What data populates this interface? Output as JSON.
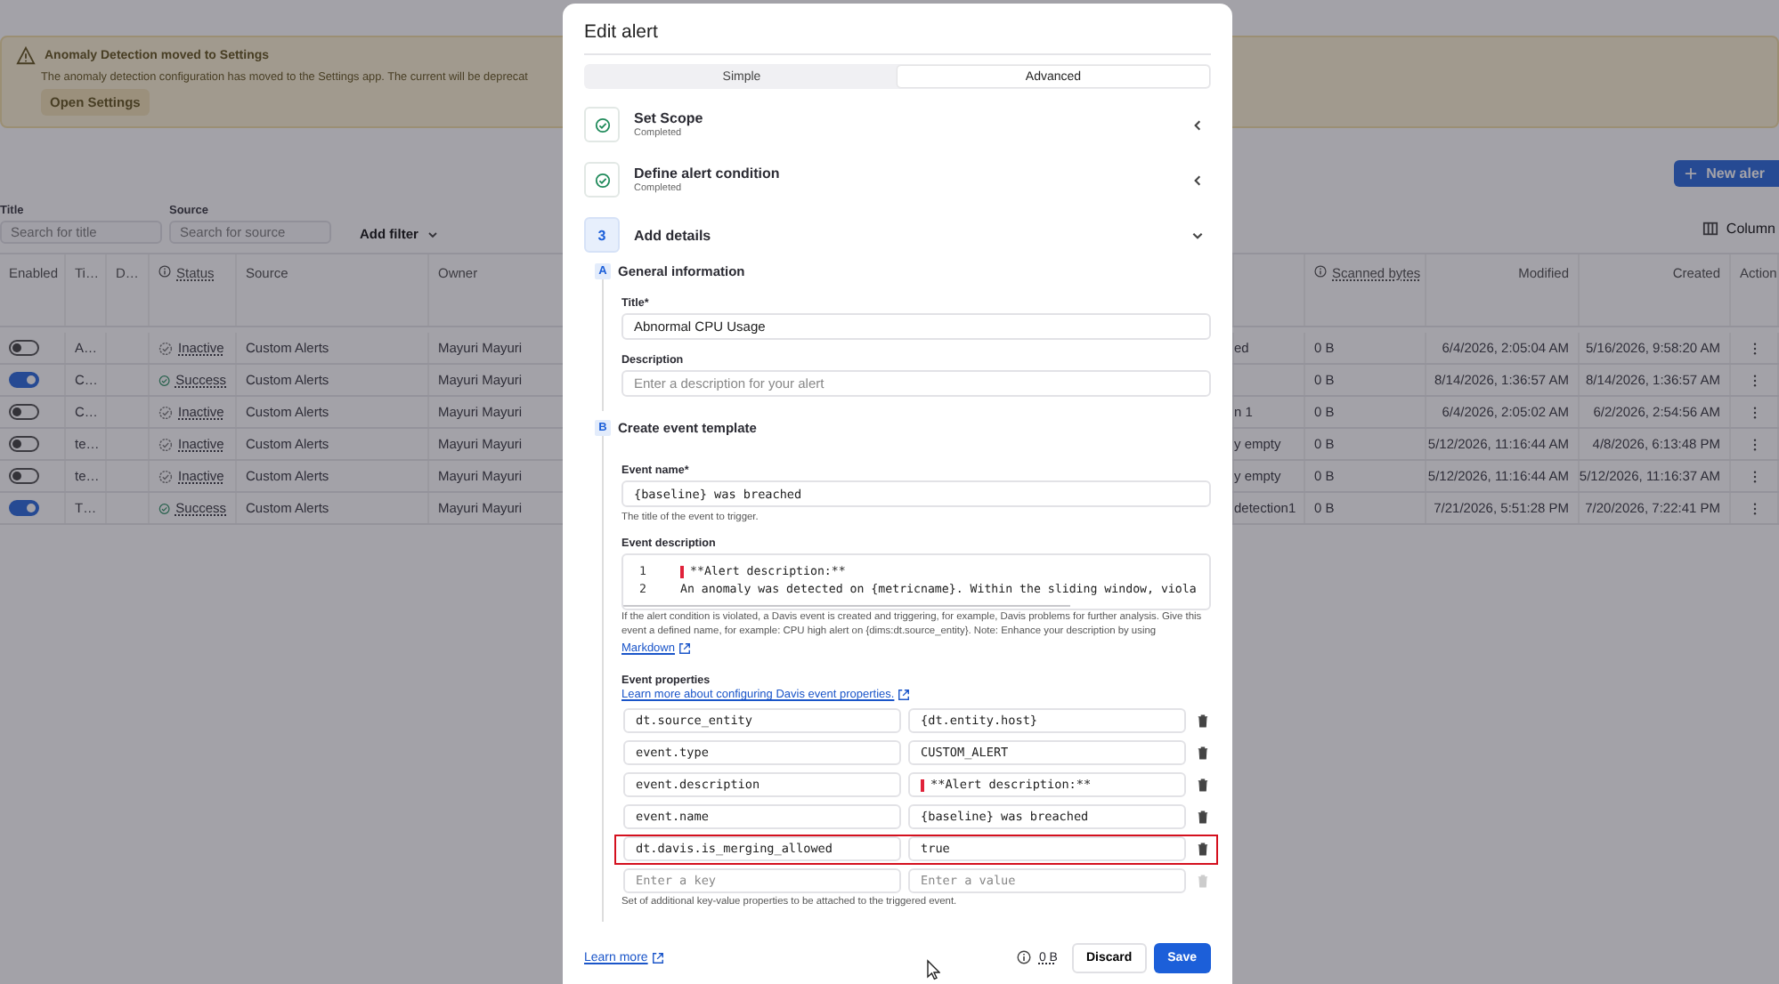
{
  "banner": {
    "title": "Anomaly Detection moved to Settings",
    "text": "The anomaly detection configuration has moved to the Settings app. The current will be deprecat",
    "button": "Open Settings"
  },
  "new_alert_button": "New aler",
  "filters": [
    {
      "label": "Title",
      "placeholder": "Search for title"
    },
    {
      "label": "Source",
      "placeholder": "Search for source"
    }
  ],
  "add_filter": "Add filter",
  "columns_button": "Column",
  "table": {
    "columns": [
      {
        "label": "Enabled",
        "kind": "plain"
      },
      {
        "label": "Ti…",
        "kind": "plain"
      },
      {
        "label": "D…",
        "kind": "plain"
      },
      {
        "label": "Status",
        "kind": "info"
      },
      {
        "label": "Source",
        "kind": "plain"
      },
      {
        "label": "Owner",
        "kind": "plain"
      },
      {
        "label": "Scanned bytes",
        "kind": "info"
      },
      {
        "label": "Modified",
        "kind": "date"
      },
      {
        "label": "Created",
        "kind": "date"
      },
      {
        "label": "Action",
        "kind": "plain"
      }
    ],
    "rows": [
      {
        "enabled": false,
        "title": "A…",
        "status": "Inactive",
        "kind": "inactive",
        "source": "Custom Alerts",
        "owner": "Mayuri Mayuri",
        "column_7": "ed",
        "scanned_bytes": "0 B",
        "modified": "6/4/2026, 2:05:04 AM",
        "created": "5/16/2026, 9:58:20 AM"
      },
      {
        "enabled": true,
        "title": "C…",
        "status": "Success",
        "kind": "success",
        "source": "Custom Alerts",
        "owner": "Mayuri Mayuri",
        "scanned_bytes": "0 B",
        "modified": "8/14/2026, 1:36:57 AM",
        "created": "8/14/2026, 1:36:57 AM"
      },
      {
        "enabled": false,
        "title": "C…",
        "status": "Inactive",
        "kind": "inactive",
        "source": "Custom Alerts",
        "owner": "Mayuri Mayuri",
        "column_7": "n 1",
        "scanned_bytes": "0 B",
        "modified": "6/4/2026, 2:05:02 AM",
        "created": "6/2/2026, 2:54:56 AM"
      },
      {
        "enabled": false,
        "title": "te…",
        "status": "Inactive",
        "kind": "inactive",
        "source": "Custom Alerts",
        "owner": "Mayuri Mayuri",
        "column_7": "y empty",
        "scanned_bytes": "0 B",
        "modified": "5/12/2026, 11:16:44 AM",
        "created": "4/8/2026, 6:13:48 PM"
      },
      {
        "enabled": false,
        "title": "te…",
        "status": "Inactive",
        "kind": "inactive",
        "source": "Custom Alerts",
        "owner": "Mayuri Mayuri",
        "column_7": "y empty",
        "scanned_bytes": "0 B",
        "modified": "5/12/2026, 11:16:44 AM",
        "created": "5/12/2026, 11:16:37 AM"
      },
      {
        "enabled": true,
        "title": "T…",
        "status": "Success",
        "kind": "success",
        "source": "Custom Alerts",
        "owner": "Mayuri Mayuri",
        "column_7": "detection1",
        "scanned_bytes": "0 B",
        "modified": "7/21/2026, 5:51:28 PM",
        "created": "7/20/2026, 7:22:41 PM"
      }
    ]
  },
  "dialog": {
    "title": "Edit alert",
    "tabs": [
      {
        "label": "Simple",
        "selected": false
      },
      {
        "label": "Advanced",
        "selected": true
      }
    ],
    "steps": [
      {
        "kind": "done",
        "title": "Set Scope",
        "subtitle": "Completed",
        "expanded": false
      },
      {
        "kind": "done",
        "title": "Define alert condition",
        "subtitle": "Completed",
        "expanded": false
      },
      {
        "kind": "number",
        "number": "3",
        "title": "Add details",
        "expanded": true
      }
    ],
    "sections": [
      {
        "letter": "A",
        "title": "General information"
      },
      {
        "letter": "B",
        "title": "Create event template"
      }
    ],
    "title_label": "Title*",
    "title_value": "Abnormal CPU Usage",
    "description_label": "Description",
    "description_placeholder": "Enter a description for your alert",
    "event_name_label": "Event name*",
    "event_name_value": "{baseline} was breached",
    "event_name_help": "The title of the event to trigger.",
    "event_description_label": "Event description",
    "code_lines": [
      {
        "number": "1",
        "text": "**Alert description:**",
        "marked": true
      },
      {
        "number": "2",
        "text": "An anomaly was detected on {metricname}. Within the sliding window, viola",
        "marked": false
      }
    ],
    "event_description_help": "If the alert condition is violated, a Davis event is created and triggering, for example, Davis problems for further analysis. Give this event a defined name, for example: CPU high alert on {dims:dt.source_entity}. Note: Enhance your description by using",
    "markdown_link": "Markdown",
    "properties_label": "Event properties",
    "properties_link": "Learn more about configuring Davis event properties.",
    "properties": [
      {
        "key": "dt.source_entity",
        "value": "{dt.entity.host}",
        "marked": false,
        "highlighted": false
      },
      {
        "key": "event.type",
        "value": "CUSTOM_ALERT",
        "marked": false,
        "highlighted": false
      },
      {
        "key": "event.description",
        "value": "**Alert description:**",
        "marked": true,
        "highlighted": false
      },
      {
        "key": "event.name",
        "value": "{baseline} was breached",
        "marked": false,
        "highlighted": false
      },
      {
        "key": "dt.davis.is_merging_allowed",
        "value": "true",
        "marked": false,
        "highlighted": true
      }
    ],
    "new_key_placeholder": "Enter a key",
    "new_value_placeholder": "Enter a value",
    "properties_help": "Set of additional key-value properties to be attached to the triggered event.",
    "learn_more": "Learn more",
    "size": "0 B",
    "discard": "Discard",
    "save": "Save"
  }
}
